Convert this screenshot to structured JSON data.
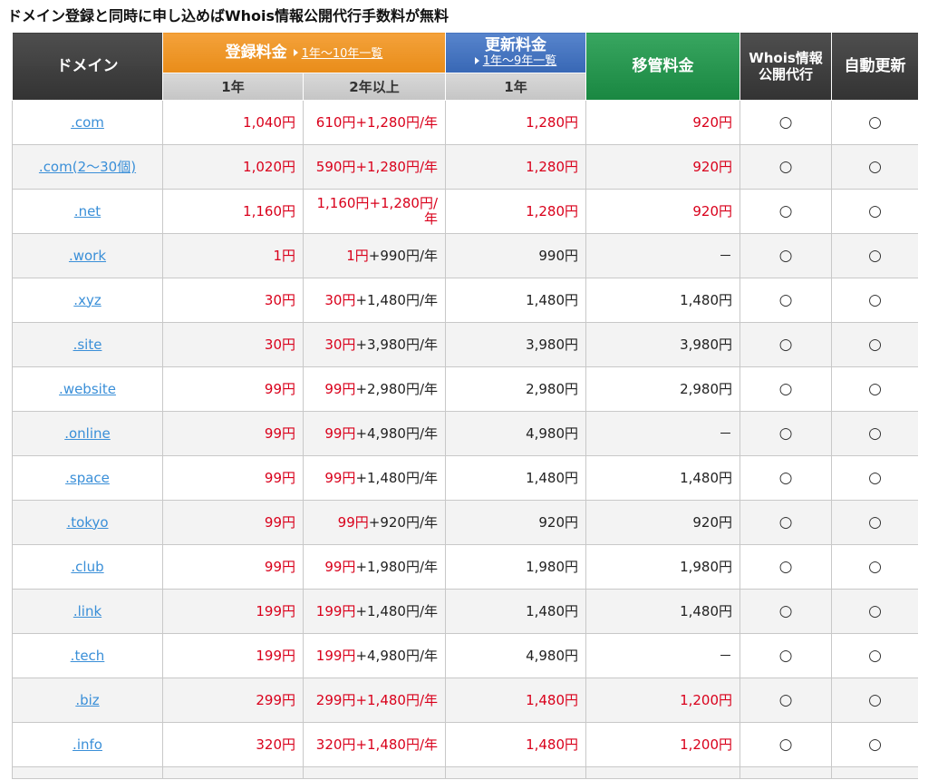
{
  "page": {
    "title": "ドメイン登録と同時に申し込めばWhois情報公開代行手数料が無料"
  },
  "colors": {
    "price_red": "#d9001b",
    "link_blue": "#3a8fd8",
    "dark_header": "#3a3a3a",
    "registration_header": "#f2921a",
    "renewal_header": "#3c70c4",
    "transfer_header": "#1c9a4a",
    "subheader_gray": "#cdcdcd",
    "row_alt": "#f3f3f3",
    "grid_line": "#c8c8c8"
  },
  "icons": {
    "header_link_arrow": "arrow-right-icon"
  },
  "header": {
    "domain": "ドメイン",
    "registration": "登録料金",
    "registration_link": "1年〜10年一覧",
    "registration_1yr": "1年",
    "registration_multi": "2年以上",
    "renewal": "更新料金",
    "renewal_link": "1年〜9年一覧",
    "renewal_1yr": "1年",
    "transfer": "移管料金",
    "whois_line1": "Whois情報",
    "whois_line2": "公開代行",
    "auto_renew": "自動更新"
  },
  "table": {
    "rows": [
      {
        "domain": ".com",
        "reg_1yr": "1,040円",
        "reg_multi_first": "610円",
        "reg_multi_rest": "+1,280円/年",
        "renew_1yr": "1,280円",
        "transfer": "920円",
        "whois": "○",
        "auto_renew": "○",
        "registration_red": true,
        "other_prices_red": true
      },
      {
        "domain": ".com(2〜30個)",
        "reg_1yr": "1,020円",
        "reg_multi_first": "590円",
        "reg_multi_rest": "+1,280円/年",
        "renew_1yr": "1,280円",
        "transfer": "920円",
        "whois": "○",
        "auto_renew": "○",
        "registration_red": true,
        "other_prices_red": true
      },
      {
        "domain": ".net",
        "reg_1yr": "1,160円",
        "reg_multi_first": "1,160円",
        "reg_multi_rest": "+1,280円/年",
        "renew_1yr": "1,280円",
        "transfer": "920円",
        "whois": "○",
        "auto_renew": "○",
        "registration_red": true,
        "other_prices_red": true
      },
      {
        "domain": ".work",
        "reg_1yr": "1円",
        "reg_multi_first": "1円",
        "reg_multi_rest": "+990円/年",
        "renew_1yr": "990円",
        "transfer": "－",
        "whois": "○",
        "auto_renew": "○",
        "registration_red": true,
        "other_prices_red": false
      },
      {
        "domain": ".xyz",
        "reg_1yr": "30円",
        "reg_multi_first": "30円",
        "reg_multi_rest": "+1,480円/年",
        "renew_1yr": "1,480円",
        "transfer": "1,480円",
        "whois": "○",
        "auto_renew": "○",
        "registration_red": true,
        "other_prices_red": false
      },
      {
        "domain": ".site",
        "reg_1yr": "30円",
        "reg_multi_first": "30円",
        "reg_multi_rest": "+3,980円/年",
        "renew_1yr": "3,980円",
        "transfer": "3,980円",
        "whois": "○",
        "auto_renew": "○",
        "registration_red": true,
        "other_prices_red": false
      },
      {
        "domain": ".website",
        "reg_1yr": "99円",
        "reg_multi_first": "99円",
        "reg_multi_rest": "+2,980円/年",
        "renew_1yr": "2,980円",
        "transfer": "2,980円",
        "whois": "○",
        "auto_renew": "○",
        "registration_red": true,
        "other_prices_red": false
      },
      {
        "domain": ".online",
        "reg_1yr": "99円",
        "reg_multi_first": "99円",
        "reg_multi_rest": "+4,980円/年",
        "renew_1yr": "4,980円",
        "transfer": "－",
        "whois": "○",
        "auto_renew": "○",
        "registration_red": true,
        "other_prices_red": false
      },
      {
        "domain": ".space",
        "reg_1yr": "99円",
        "reg_multi_first": "99円",
        "reg_multi_rest": "+1,480円/年",
        "renew_1yr": "1,480円",
        "transfer": "1,480円",
        "whois": "○",
        "auto_renew": "○",
        "registration_red": true,
        "other_prices_red": false
      },
      {
        "domain": ".tokyo",
        "reg_1yr": "99円",
        "reg_multi_first": "99円",
        "reg_multi_rest": "+920円/年",
        "renew_1yr": "920円",
        "transfer": "920円",
        "whois": "○",
        "auto_renew": "○",
        "registration_red": true,
        "other_prices_red": false
      },
      {
        "domain": ".club",
        "reg_1yr": "99円",
        "reg_multi_first": "99円",
        "reg_multi_rest": "+1,980円/年",
        "renew_1yr": "1,980円",
        "transfer": "1,980円",
        "whois": "○",
        "auto_renew": "○",
        "registration_red": true,
        "other_prices_red": false
      },
      {
        "domain": ".link",
        "reg_1yr": "199円",
        "reg_multi_first": "199円",
        "reg_multi_rest": "+1,480円/年",
        "renew_1yr": "1,480円",
        "transfer": "1,480円",
        "whois": "○",
        "auto_renew": "○",
        "registration_red": true,
        "other_prices_red": false
      },
      {
        "domain": ".tech",
        "reg_1yr": "199円",
        "reg_multi_first": "199円",
        "reg_multi_rest": "+4,980円/年",
        "renew_1yr": "4,980円",
        "transfer": "－",
        "whois": "○",
        "auto_renew": "○",
        "registration_red": true,
        "other_prices_red": false
      },
      {
        "domain": ".biz",
        "reg_1yr": "299円",
        "reg_multi_first": "299円",
        "reg_multi_rest": "+1,480円/年",
        "renew_1yr": "1,480円",
        "transfer": "1,200円",
        "whois": "○",
        "auto_renew": "○",
        "registration_red": true,
        "other_prices_red": true
      },
      {
        "domain": ".info",
        "reg_1yr": "320円",
        "reg_multi_first": "320円",
        "reg_multi_rest": "+1,480円/年",
        "renew_1yr": "1,480円",
        "transfer": "1,200円",
        "whois": "○",
        "auto_renew": "○",
        "registration_red": true,
        "other_prices_red": true
      }
    ]
  }
}
